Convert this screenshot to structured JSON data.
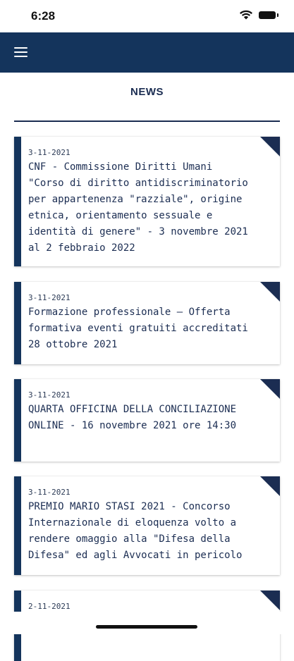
{
  "status": {
    "time": "6:28"
  },
  "page": {
    "title": "NEWS"
  },
  "news": [
    {
      "date": "3-11-2021",
      "text": "CNF - Commissione Diritti Umani \"Corso di diritto antidiscriminatorio per appartenenza \"razziale\", origine etnica, orientamento sessuale e identità di genere\" - 3 novembre 2021 al 2 febbraio 2022"
    },
    {
      "date": "3-11-2021",
      "text": "Formazione professionale – Offerta formativa eventi gratuiti accreditati 28 ottobre 2021"
    },
    {
      "date": "3-11-2021",
      "text": "QUARTA OFFICINA DELLA CONCILIAZIONE ONLINE - 16 novembre 2021 ore 14:30"
    },
    {
      "date": "3-11-2021",
      "text": "PREMIO MARIO STASI 2021 - Concorso Internazionale di eloquenza volto a rendere omaggio alla \"Difesa della Difesa\" ed agli Avvocati in pericolo"
    },
    {
      "date": "2-11-2021",
      "text": ""
    }
  ],
  "colors": {
    "navy": "#14345c",
    "text": "#1b2d52",
    "background": "#ffffff"
  },
  "icons": {
    "menu": "hamburger-menu-icon",
    "wifi": "wifi-icon",
    "battery": "battery-icon"
  }
}
